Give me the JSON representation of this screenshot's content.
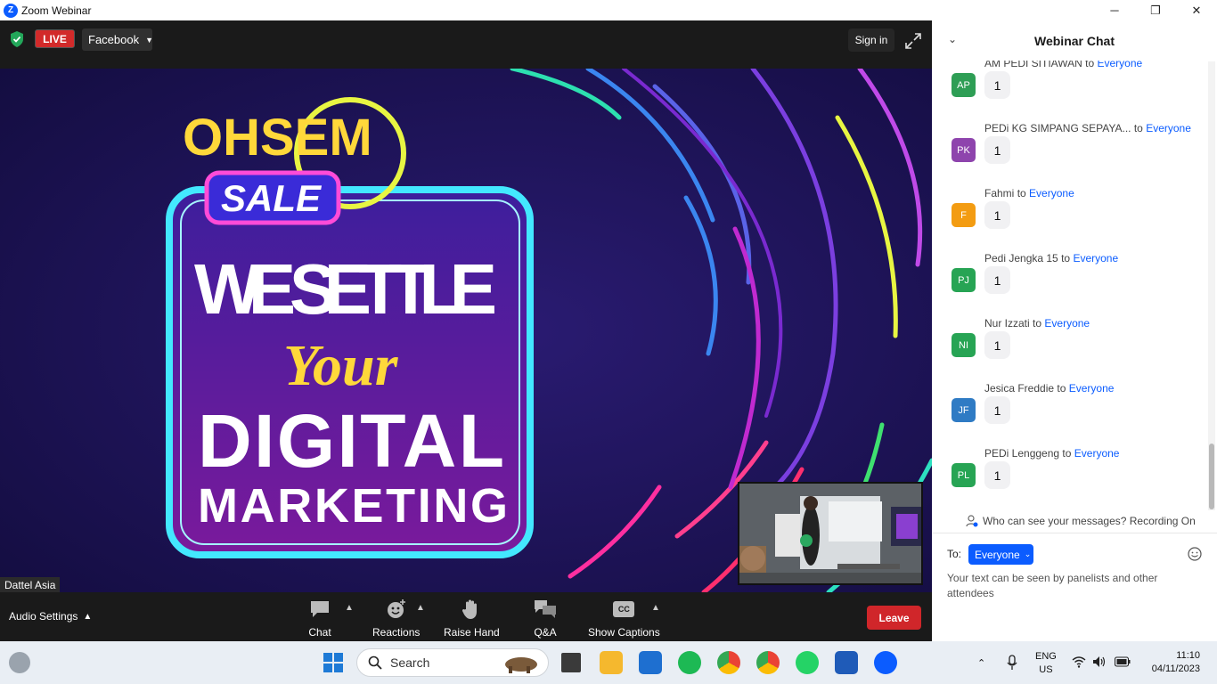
{
  "window": {
    "title": "Zoom Webinar",
    "minimize": "─",
    "restore": "❐",
    "close": "✕"
  },
  "topbar": {
    "live_label": "LIVE",
    "stream_target": "Facebook",
    "signin_label": "Sign in"
  },
  "video": {
    "presenter_name": "Dattel Asia",
    "poster_lines": [
      "OHSEM",
      "SALE",
      "WE SETTLE",
      "Your",
      "DIGITAL",
      "MARKETING"
    ]
  },
  "controls": {
    "audio_settings": "Audio Settings",
    "buttons": [
      {
        "label": "Chat",
        "icon": "chat-icon"
      },
      {
        "label": "Reactions",
        "icon": "reactions-icon"
      },
      {
        "label": "Raise Hand",
        "icon": "raise-hand-icon"
      },
      {
        "label": "Q&A",
        "icon": "qa-icon"
      },
      {
        "label": "Show Captions",
        "icon": "captions-icon",
        "badge": "CC"
      }
    ],
    "leave_label": "Leave"
  },
  "chat": {
    "title": "Webinar Chat",
    "messages": [
      {
        "initials": "AP",
        "sender": "AM PEDI SITIAWAN",
        "to": "to",
        "recipient": "Everyone",
        "text": "1",
        "color": "#2e9e55"
      },
      {
        "initials": "PK",
        "sender": "PEDi KG SIMPANG SEPAYA...",
        "to": "to",
        "recipient": "Everyone",
        "text": "1",
        "color": "#8e44ad"
      },
      {
        "initials": "F",
        "sender": "Fahmi",
        "to": "to",
        "recipient": "Everyone",
        "text": "1",
        "color": "#f39c12"
      },
      {
        "initials": "PJ",
        "sender": "Pedi Jengka 15",
        "to": "to",
        "recipient": "Everyone",
        "text": "1",
        "color": "#27a454"
      },
      {
        "initials": "NI",
        "sender": "Nur Izzati",
        "to": "to",
        "recipient": "Everyone",
        "text": "1",
        "color": "#27a454"
      },
      {
        "initials": "JF",
        "sender": "Jesica  Freddie",
        "to": "to",
        "recipient": "Everyone",
        "text": "1",
        "color": "#2f7bc4"
      },
      {
        "initials": "PL",
        "sender": "PEDi Lenggeng",
        "to": "to",
        "recipient": "Everyone",
        "text": "1",
        "color": "#27a454"
      }
    ],
    "visibility_note": "Who can see your messages? Recording On",
    "to_label": "To:",
    "to_value": "Everyone",
    "input_placeholder": "Your text can be seen by panelists and other attendees"
  },
  "taskbar": {
    "search_label": "Search",
    "language": "ENG",
    "region": "US",
    "time": "11:10",
    "date": "04/11/2023"
  }
}
